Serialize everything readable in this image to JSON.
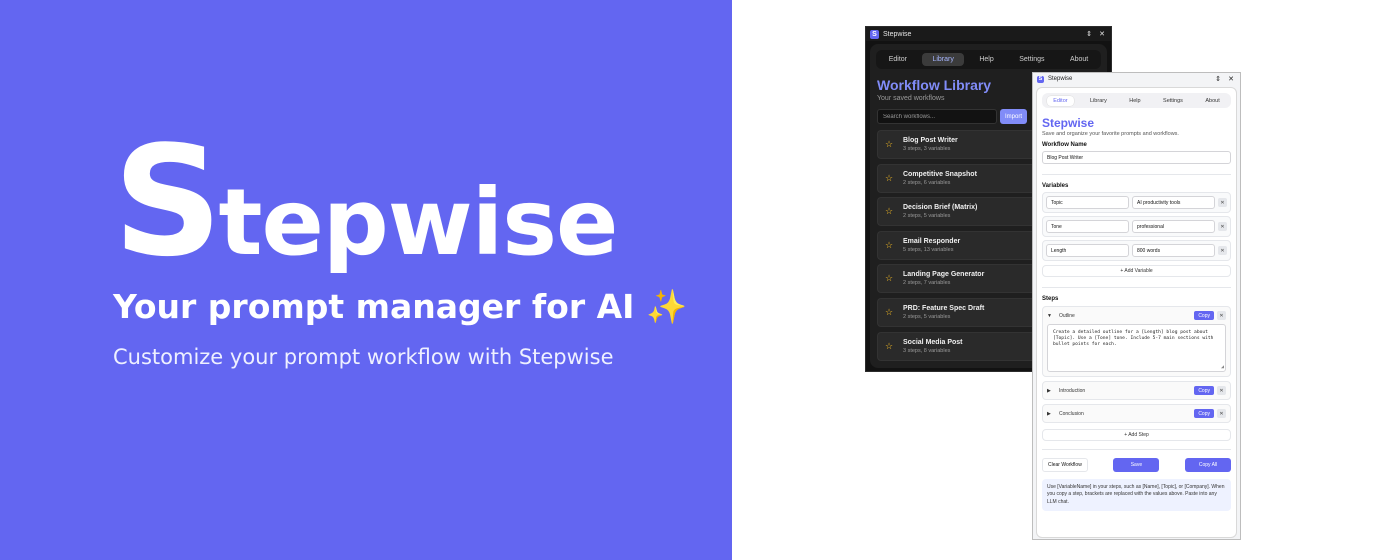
{
  "hero": {
    "title_first": "S",
    "title_rest": "tepwise",
    "tagline": "Your prompt manager for AI",
    "sparkle": "✨",
    "subtitle": "Customize your prompt workflow with Stepwise"
  },
  "colors": {
    "accent": "#6366f1",
    "star": "#fbbf24"
  },
  "library_window": {
    "app_name": "Stepwise",
    "logo_letter": "S",
    "pin": "⇕",
    "close": "✕",
    "tabs": [
      {
        "label": "Editor"
      },
      {
        "label": "Library"
      },
      {
        "label": "Help"
      },
      {
        "label": "Settings"
      },
      {
        "label": "About"
      }
    ],
    "active_tab": "Library",
    "title": "Workflow Library",
    "subtitle": "Your saved workflows",
    "search_placeholder": "Search workflows...",
    "import_label": "Import",
    "workflows": [
      {
        "name": "Blog Post Writer",
        "meta": "3 steps, 3 variables"
      },
      {
        "name": "Competitive Snapshot",
        "meta": "2 steps, 6 variables"
      },
      {
        "name": "Decision Brief (Matrix)",
        "meta": "2 steps, 5 variables"
      },
      {
        "name": "Email Responder",
        "meta": "5 steps, 13 variables"
      },
      {
        "name": "Landing Page Generator",
        "meta": "2 steps, 7 variables"
      },
      {
        "name": "PRD: Feature Spec Draft",
        "meta": "2 steps, 5 variables"
      },
      {
        "name": "Social Media Post",
        "meta": "3 steps, 8 variables"
      }
    ]
  },
  "editor_window": {
    "app_name": "Stepwise",
    "logo_letter": "S",
    "pin": "⇕",
    "close": "✕",
    "tabs": [
      {
        "label": "Editor"
      },
      {
        "label": "Library"
      },
      {
        "label": "Help"
      },
      {
        "label": "Settings"
      },
      {
        "label": "About"
      }
    ],
    "active_tab": "Editor",
    "title": "Stepwise",
    "subtitle": "Save and organize your favorite prompts and workflows.",
    "workflow_name_label": "Workflow Name",
    "workflow_name_value": "Blog Post Writer",
    "variables_label": "Variables",
    "variables": [
      {
        "name": "Topic",
        "value": "AI productivity tools"
      },
      {
        "name": "Tone",
        "value": "professional"
      },
      {
        "name": "Length",
        "value": "800 words"
      }
    ],
    "add_variable_label": "+ Add Variable",
    "steps_label": "Steps",
    "steps": [
      {
        "name": "Outline",
        "caret": "▼",
        "expanded": true,
        "text": "Create a detailed outline for a [Length] blog post about [Topic]. Use a [Tone] tone. Include 5-7 main sections with bullet points for each."
      },
      {
        "name": "Introduction",
        "caret": "▶",
        "expanded": false,
        "text": ""
      },
      {
        "name": "Conclusion",
        "caret": "▶",
        "expanded": false,
        "text": ""
      }
    ],
    "copy_label": "Copy",
    "remove_label": "✕",
    "add_step_label": "+ Add Step",
    "clear_label": "Clear Workflow",
    "save_label": "Save",
    "copy_all_label": "Copy All",
    "hint": "Use [VariableName] in your steps, such as [Name], [Topic], or [Company]. When you copy a step, brackets are replaced with the values above. Paste into any LLM chat."
  }
}
